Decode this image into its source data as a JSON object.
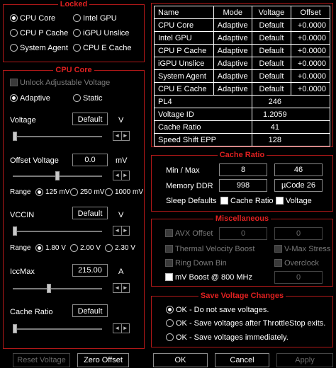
{
  "locked": {
    "title": "Locked",
    "options": [
      "CPU Core",
      "Intel GPU",
      "CPU P Cache",
      "iGPU Unslice",
      "System Agent",
      "CPU E Cache"
    ]
  },
  "cpu_core": {
    "title": "CPU Core",
    "unlock_label": "Unlock Adjustable Voltage",
    "adaptive_label": "Adaptive",
    "static_label": "Static",
    "voltage_label": "Voltage",
    "voltage_value": "Default",
    "voltage_unit": "V",
    "offset_label": "Offset Voltage",
    "offset_value": "0.0",
    "offset_unit": "mV",
    "range_label": "Range",
    "offset_ranges": [
      "125 mV",
      "250 mV",
      "1000 mV"
    ],
    "vccin_label": "VCCIN",
    "vccin_value": "Default",
    "vccin_unit": "V",
    "vccin_ranges": [
      "1.80 V",
      "2.00 V",
      "2.30 V"
    ],
    "iccmax_label": "IccMax",
    "iccmax_value": "215.00",
    "iccmax_unit": "A",
    "cache_ratio_label": "Cache Ratio",
    "cache_ratio_value": "Default",
    "voltage_slider": 0.0,
    "offset_slider": 0.5,
    "vccin_slider": 0.0,
    "iccmax_slider": 0.4,
    "cache_slider": 0.0
  },
  "table": {
    "headers": [
      "Name",
      "Mode",
      "Voltage",
      "Offset"
    ],
    "rows4": [
      [
        "CPU Core",
        "Adaptive",
        "Default",
        "+0.0000"
      ],
      [
        "Intel GPU",
        "Adaptive",
        "Default",
        "+0.0000"
      ],
      [
        "CPU P Cache",
        "Adaptive",
        "Default",
        "+0.0000"
      ],
      [
        "iGPU Unslice",
        "Adaptive",
        "Default",
        "+0.0000"
      ],
      [
        "System Agent",
        "Adaptive",
        "Default",
        "+0.0000"
      ],
      [
        "CPU E Cache",
        "Adaptive",
        "Default",
        "+0.0000"
      ]
    ],
    "rows2": [
      [
        "PL4",
        "246"
      ],
      [
        "Voltage ID",
        "1.2059"
      ],
      [
        "Cache Ratio",
        "41"
      ],
      [
        "Speed Shift EPP",
        "128"
      ]
    ]
  },
  "cache_ratio": {
    "title": "Cache Ratio",
    "minmax_label": "Min / Max",
    "min_value": "8",
    "max_value": "46",
    "ddr_label": "Memory DDR",
    "ddr_value": "998",
    "ucode_value": "µCode 26",
    "sleep_label": "Sleep Defaults",
    "sleep_cache": "Cache Ratio",
    "sleep_voltage": "Voltage"
  },
  "misc": {
    "title": "Miscellaneous",
    "avx_label": "AVX Offset",
    "avx_value1": "0",
    "avx_value2": "0",
    "tvb_label": "Thermal Velocity Boost",
    "vmax_label": "V-Max Stress",
    "ringdown_label": "Ring Down Bin",
    "overclock_label": "Overclock",
    "mvboost_label": "mV Boost @ 800 MHz",
    "mvboost_value": "0"
  },
  "save": {
    "title": "Save Voltage Changes",
    "options": [
      "OK - Do not save voltages.",
      "OK - Save voltages after ThrottleStop exits.",
      "OK - Save voltages immediately."
    ]
  },
  "buttons": {
    "reset": "Reset Voltage",
    "zero": "Zero Offset",
    "ok": "OK",
    "cancel": "Cancel",
    "apply": "Apply"
  },
  "colors": {
    "accent": "#e02020",
    "border": "#b01818"
  }
}
